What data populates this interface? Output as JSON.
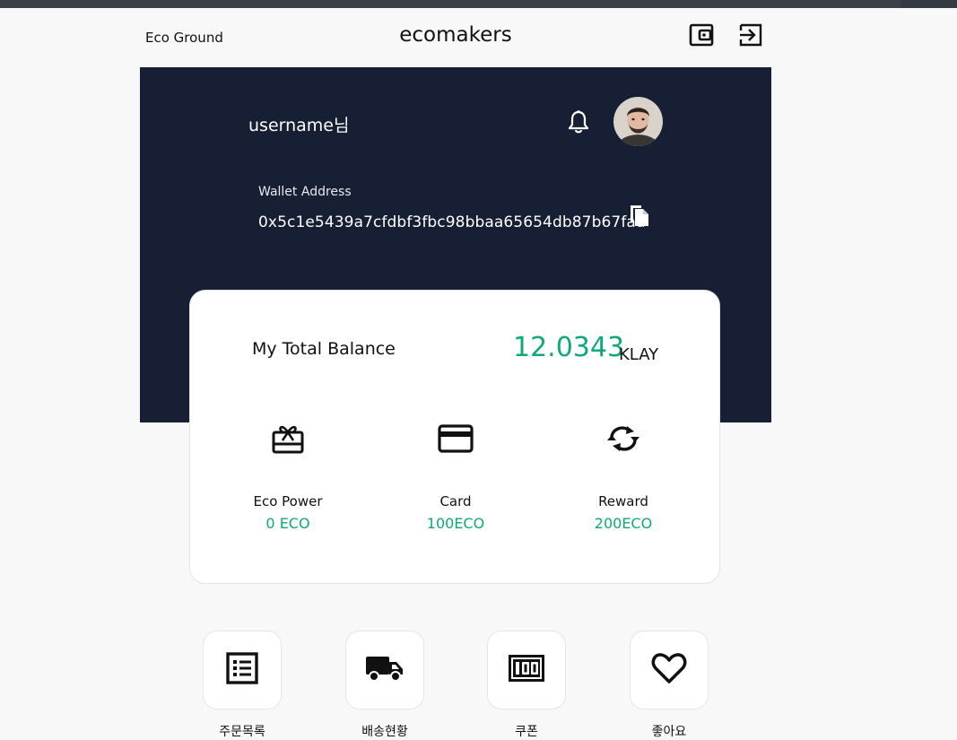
{
  "header": {
    "left_title": "Eco Ground",
    "brand": "ecomakers",
    "icons": [
      "wallet-icon",
      "logout-icon"
    ]
  },
  "profile": {
    "username": "username님",
    "wallet_label": "Wallet Address",
    "wallet_address": "0x5c1e5439a7cfdbf3fbc98bbaa65654db87b67fad"
  },
  "balance": {
    "label": "My Total Balance",
    "value": "12.0343",
    "unit": "KLAY"
  },
  "stats": [
    {
      "label": "Eco Power",
      "value": "0 ECO",
      "icon": "gift-card-icon"
    },
    {
      "label": "Card",
      "value": "100ECO",
      "icon": "credit-card-icon"
    },
    {
      "label": "Reward",
      "value": "200ECO",
      "icon": "sync-icon"
    }
  ],
  "menu": [
    {
      "label": "주문목록",
      "icon": "order-list-icon"
    },
    {
      "label": "배송현황",
      "icon": "truck-icon"
    },
    {
      "label": "쿠폰",
      "icon": "coupon-icon"
    },
    {
      "label": "좋아요",
      "icon": "heart-icon"
    }
  ],
  "colors": {
    "hero_bg": "#161f33",
    "accent": "#0fa979",
    "page_bg": "#f8f8f8"
  }
}
